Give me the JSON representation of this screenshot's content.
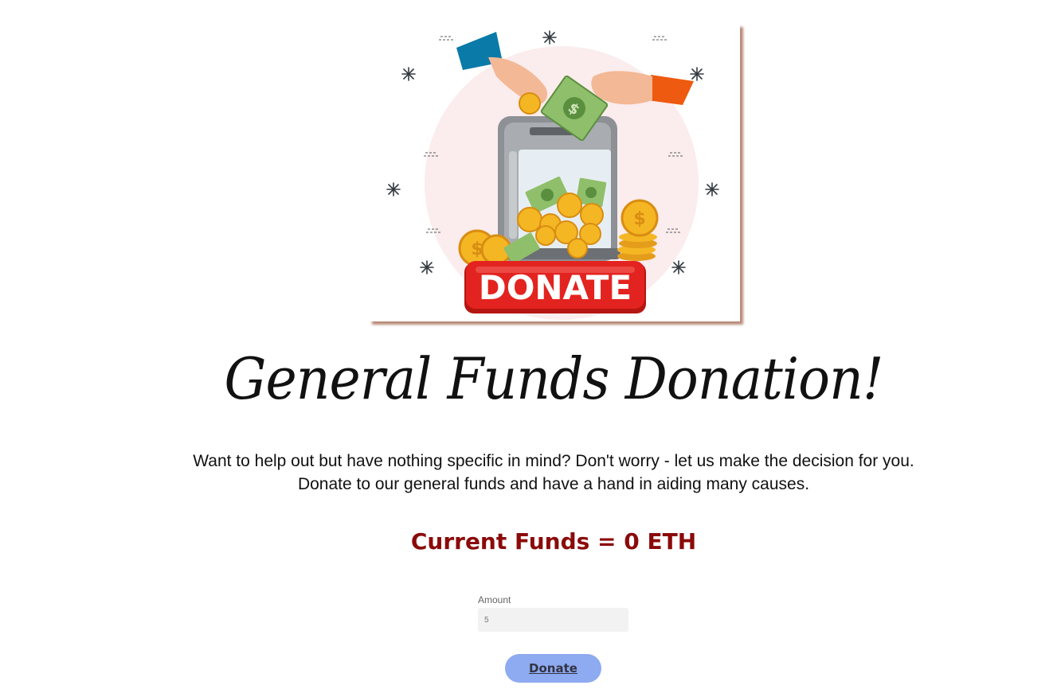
{
  "hero": {
    "banner_text": "DONATE",
    "colors": {
      "circle": "#fbeced",
      "banner": "#e3231f",
      "coin": "#f5b623",
      "bill": "#8fbf6a",
      "sleeve_left": "#0a7aa8",
      "sleeve_right": "#ee5a0f"
    }
  },
  "page": {
    "title": "General Funds Donation!",
    "intro_line1": "Want to help out but have nothing specific in mind? Don't worry - let us make the decision for you.",
    "intro_line2": "Donate to our general funds and have a hand in aiding many causes."
  },
  "funds": {
    "text": "Current Funds = 0 ETH",
    "color": "#8b0a0a"
  },
  "form": {
    "amount_label": "Amount",
    "amount_placeholder": "5",
    "donate_label": "Donate",
    "button_color": "#8eaaf0"
  }
}
